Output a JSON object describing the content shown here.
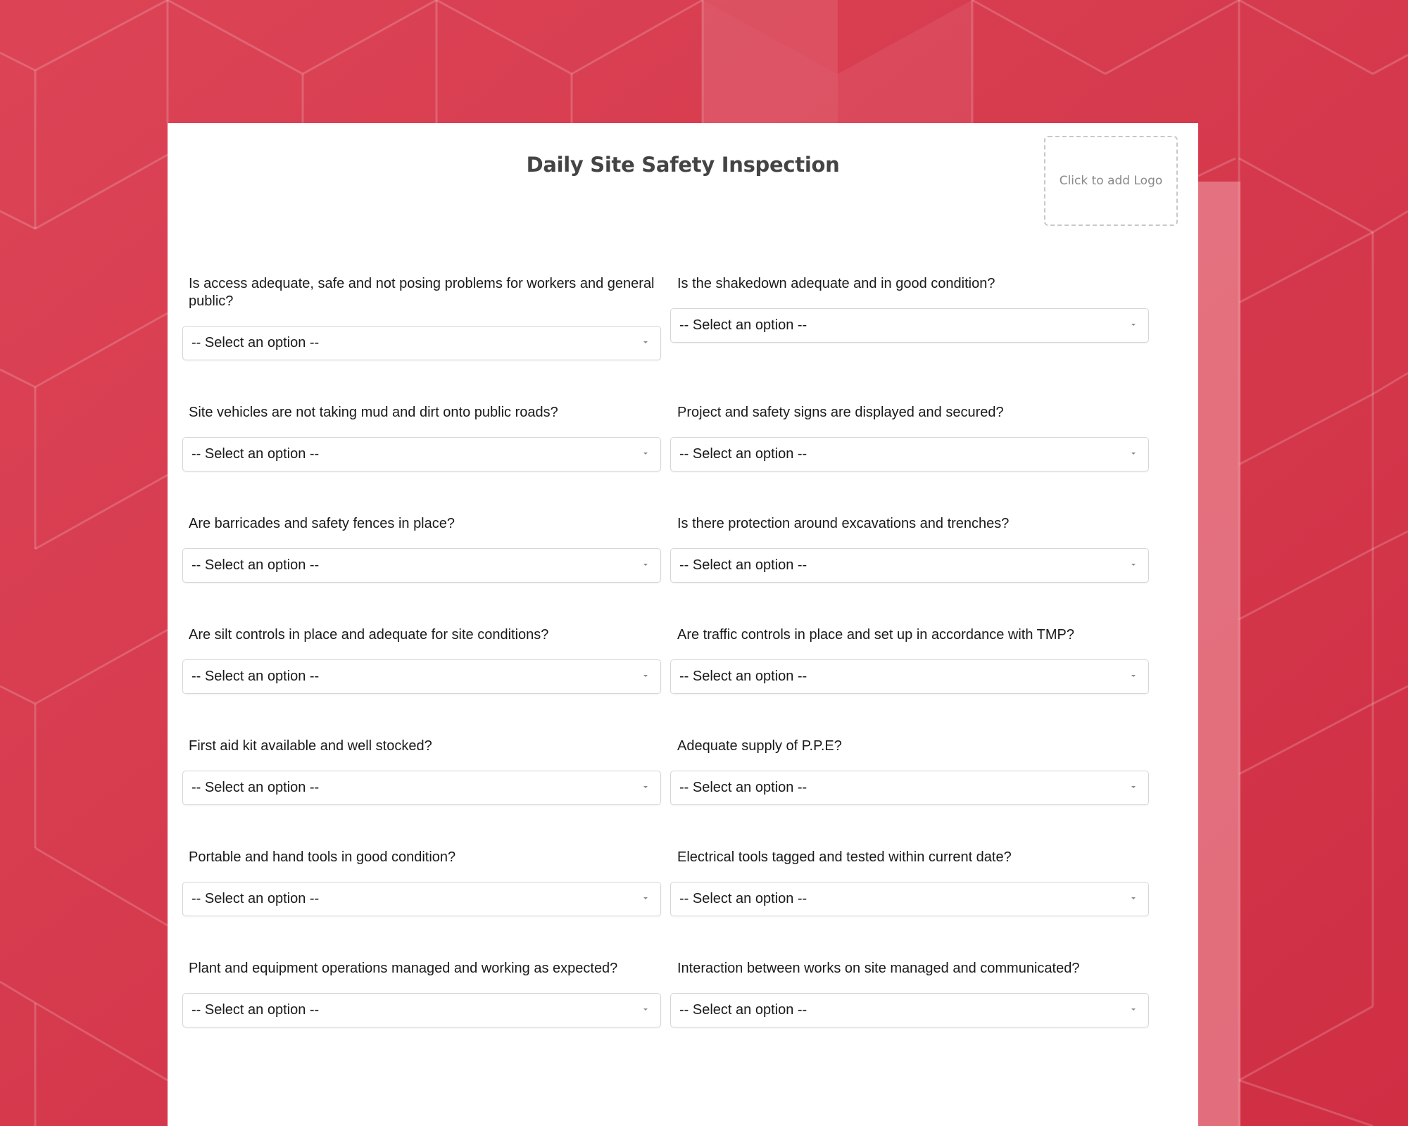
{
  "colors": {
    "background": "#d5374a",
    "card": "#ffffff",
    "title": "#444444",
    "select_border": "#d6d6d6"
  },
  "form": {
    "title": "Daily Site Safety Inspection",
    "logo_placeholder": "Click to add Logo",
    "questions": [
      {
        "label": "Is access adequate, safe and not posing problems for workers and general public?",
        "value": "-- Select an option --"
      },
      {
        "label": "Is the shakedown adequate and in good condition?",
        "value": "-- Select an option --"
      },
      {
        "label": "Site vehicles are not taking mud and dirt onto public roads?",
        "value": "-- Select an option --"
      },
      {
        "label": "Project and safety signs are displayed and secured?",
        "value": "-- Select an option --"
      },
      {
        "label": "Are barricades and safety fences in place?",
        "value": "-- Select an option --"
      },
      {
        "label": "Is there protection around excavations and trenches?",
        "value": "-- Select an option --"
      },
      {
        "label": "Are silt controls in place and adequate for site conditions?",
        "value": "-- Select an option --"
      },
      {
        "label": "Are traffic controls in place and set up in accordance with TMP?",
        "value": "-- Select an option --"
      },
      {
        "label": "First aid kit available and well stocked?",
        "value": "-- Select an option --"
      },
      {
        "label": "Adequate supply of P.P.E?",
        "value": "-- Select an option --"
      },
      {
        "label": "Portable and hand tools in good condition?",
        "value": "-- Select an option --"
      },
      {
        "label": "Electrical tools tagged and tested within current date?",
        "value": "-- Select an option --"
      },
      {
        "label": "Plant and equipment operations managed and working as expected?",
        "value": "-- Select an option --"
      },
      {
        "label": "Interaction between works on site managed and communicated?",
        "value": "-- Select an option --"
      }
    ]
  }
}
